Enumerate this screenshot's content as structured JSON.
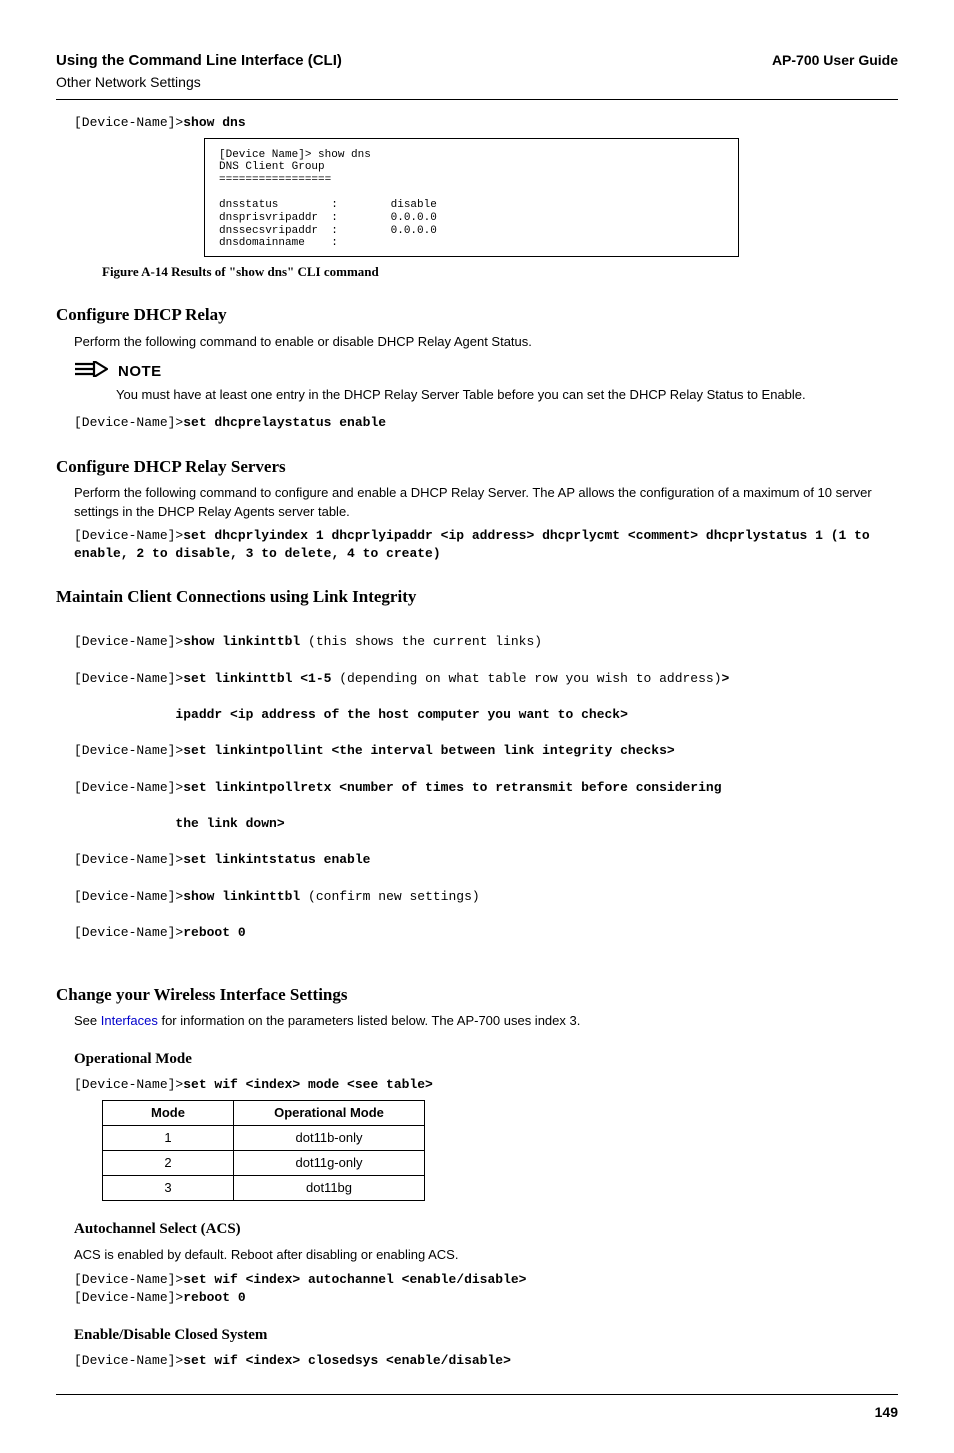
{
  "header": {
    "title": "Using the Command Line Interface (CLI)",
    "guide": "AP-700 User Guide",
    "subtitle": "Other Network Settings"
  },
  "cmd_show_dns_prefix": "[Device-Name]>",
  "cmd_show_dns": "show dns",
  "fig_box": "[Device Name]> show dns\nDNS Client Group\n=================\n\ndnsstatus        :        disable\ndnsprisvripaddr  :        0.0.0.0\ndnssecsvripaddr  :        0.0.0.0\ndnsdomainname    :",
  "fig_caption": "Figure A-14   Results of \"show dns\" CLI command",
  "sec1": {
    "title": "Configure DHCP Relay",
    "text": "Perform the following command to enable or disable DHCP Relay Agent Status.",
    "note_label": "NOTE",
    "note_text": "You must have at least one entry in the DHCP Relay Server Table before you can set the DHCP Relay Status to Enable.",
    "cmd_prefix": "[Device-Name]>",
    "cmd": "set dhcprelaystatus enable"
  },
  "sec2": {
    "title": "Configure DHCP Relay Servers",
    "text": "Perform the following command to configure and enable a DHCP Relay Server. The AP allows the configuration of a maximum of 10 server settings in the DHCP Relay Agents server table.",
    "cmd_prefix": "[Device-Name]>",
    "cmd": "set dhcprlyindex 1 dhcprlyipaddr <ip address> dhcprlycmt <comment> dhcprlystatus 1 (1 to enable, 2 to disable, 3 to delete, 4 to create)"
  },
  "sec3": {
    "title": "Maintain Client Connections using Link Integrity",
    "lines": {
      "l1p": "[Device-Name]>",
      "l1b": "show linkinttbl",
      "l1a": " (this shows the current links)",
      "l2p": "[Device-Name]>",
      "l2b": "set linkinttbl <1-5",
      "l2a": " (depending on what table row you wish to address)",
      "l2c": ">",
      "l3b": "             ipaddr <ip address of the host computer you want to check>",
      "l4p": "[Device-Name]>",
      "l4b": "set linkintpollint <the interval between link integrity checks>",
      "l5p": "[Device-Name]>",
      "l5b": "set linkintpollretx <number of times to retransmit before considering",
      "l6b": "             the link down>",
      "l7p": "[Device-Name]>",
      "l7b": "set linkintstatus enable",
      "l8p": "[Device-Name]>",
      "l8b": "show linkinttbl",
      "l8a": " (confirm new settings)",
      "l9p": "[Device-Name]>",
      "l9b": "reboot 0"
    }
  },
  "sec4": {
    "title": "Change your Wireless Interface Settings",
    "text_pre": "See ",
    "link": "Interfaces",
    "text_post": " for information on the parameters listed below. The AP-700 uses index 3."
  },
  "sub_op": {
    "title": "Operational Mode",
    "cmd_prefix": "[Device-Name]>",
    "cmd": "set wif <index> mode <see table>",
    "th1": "Mode",
    "th2": "Operational Mode",
    "rows": [
      {
        "a": "1",
        "b": "dot11b-only"
      },
      {
        "a": "2",
        "b": "dot11g-only"
      },
      {
        "a": "3",
        "b": "dot11bg"
      }
    ]
  },
  "sub_acs": {
    "title": "Autochannel Select (ACS)",
    "text": "ACS is enabled by default. Reboot after disabling or enabling ACS.",
    "cmd1_prefix": "[Device-Name]>",
    "cmd1": "set wif <index> autochannel <enable/disable>",
    "cmd2_prefix": "[Device-Name]>",
    "cmd2": "reboot 0"
  },
  "sub_closed": {
    "title": "Enable/Disable Closed System",
    "cmd_prefix": "[Device-Name]>",
    "cmd": "set wif <index> closedsys <enable/disable>"
  },
  "page_number": "149"
}
